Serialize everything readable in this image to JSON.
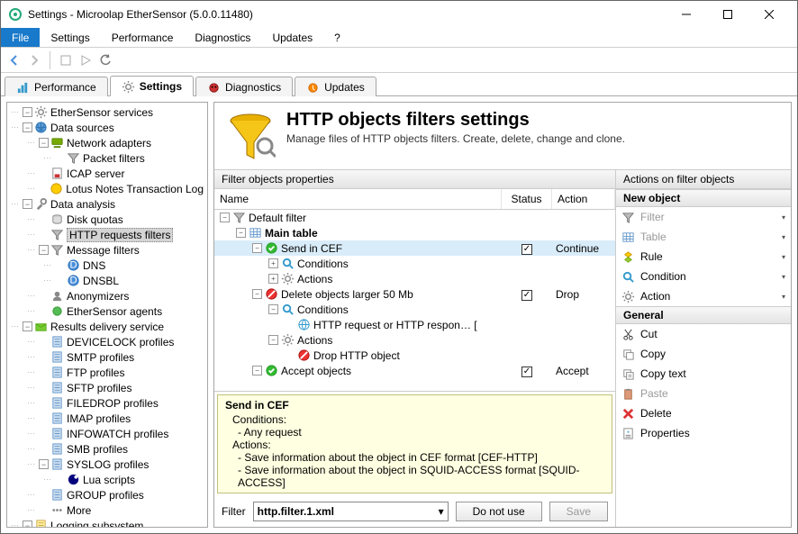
{
  "window": {
    "title": "Settings - Microolap EtherSensor (5.0.0.11480)"
  },
  "menubar": [
    "File",
    "Settings",
    "Performance",
    "Diagnostics",
    "Updates",
    "?"
  ],
  "tabs": [
    {
      "label": "Performance",
      "icon": "chart"
    },
    {
      "label": "Settings",
      "icon": "gear",
      "active": true
    },
    {
      "label": "Diagnostics",
      "icon": "bug"
    },
    {
      "label": "Updates",
      "icon": "update"
    }
  ],
  "sidebar": [
    {
      "d": 0,
      "e": "-",
      "i": "gear",
      "t": "EtherSensor services"
    },
    {
      "d": 0,
      "e": "-",
      "i": "globe",
      "t": "Data sources"
    },
    {
      "d": 1,
      "e": "-",
      "i": "net",
      "t": "Network adapters"
    },
    {
      "d": 2,
      "e": "",
      "i": "filter",
      "t": "Packet filters"
    },
    {
      "d": 1,
      "e": "",
      "i": "icap",
      "t": "ICAP server"
    },
    {
      "d": 1,
      "e": "",
      "i": "lotus",
      "t": "Lotus Notes Transaction Log"
    },
    {
      "d": 0,
      "e": "-",
      "i": "tools",
      "t": "Data analysis"
    },
    {
      "d": 1,
      "e": "",
      "i": "disk",
      "t": "Disk quotas"
    },
    {
      "d": 1,
      "e": "",
      "i": "filter",
      "t": "HTTP requests filters",
      "sel": true
    },
    {
      "d": 1,
      "e": "-",
      "i": "filter",
      "t": "Message filters"
    },
    {
      "d": 2,
      "e": "",
      "i": "dns",
      "t": "DNS"
    },
    {
      "d": 2,
      "e": "",
      "i": "dns",
      "t": "DNSBL"
    },
    {
      "d": 1,
      "e": "",
      "i": "anon",
      "t": "Anonymizers"
    },
    {
      "d": 1,
      "e": "",
      "i": "agent",
      "t": "EtherSensor agents"
    },
    {
      "d": 0,
      "e": "-",
      "i": "deliv",
      "t": "Results delivery service"
    },
    {
      "d": 1,
      "e": "",
      "i": "prof",
      "t": "DEVICELOCK profiles"
    },
    {
      "d": 1,
      "e": "",
      "i": "prof",
      "t": "SMTP profiles"
    },
    {
      "d": 1,
      "e": "",
      "i": "prof",
      "t": "FTP profiles"
    },
    {
      "d": 1,
      "e": "",
      "i": "prof",
      "t": "SFTP profiles"
    },
    {
      "d": 1,
      "e": "",
      "i": "prof",
      "t": "FILEDROP profiles"
    },
    {
      "d": 1,
      "e": "",
      "i": "prof",
      "t": "IMAP profiles"
    },
    {
      "d": 1,
      "e": "",
      "i": "prof",
      "t": "INFOWATCH profiles"
    },
    {
      "d": 1,
      "e": "",
      "i": "prof",
      "t": "SMB profiles"
    },
    {
      "d": 1,
      "e": "-",
      "i": "prof",
      "t": "SYSLOG profiles"
    },
    {
      "d": 2,
      "e": "",
      "i": "lua",
      "t": "Lua scripts"
    },
    {
      "d": 1,
      "e": "",
      "i": "prof",
      "t": "GROUP profiles"
    },
    {
      "d": 1,
      "e": "",
      "i": "more",
      "t": "More"
    },
    {
      "d": 0,
      "e": "-",
      "i": "log",
      "t": "Logging subsystem"
    }
  ],
  "main": {
    "title": "HTTP objects filters settings",
    "subtitle": "Manage files of HTTP objects filters. Create, delete, change and clone.",
    "filterPaneTitle": "Filter objects properties",
    "actionsPaneTitle": "Actions on filter objects",
    "cols": {
      "name": "Name",
      "status": "Status",
      "action": "Action"
    },
    "rows": [
      {
        "d": 0,
        "e": "-",
        "i": "filter",
        "t": "Default filter"
      },
      {
        "d": 1,
        "e": "-",
        "i": "table",
        "t": "Main table",
        "bold": true
      },
      {
        "d": 2,
        "e": "-",
        "i": "ok",
        "t": "Send in CEF",
        "chk": true,
        "act": "Continue",
        "sel": true
      },
      {
        "d": 3,
        "e": "+",
        "i": "cond",
        "t": "Conditions"
      },
      {
        "d": 3,
        "e": "+",
        "i": "act",
        "t": "Actions"
      },
      {
        "d": 2,
        "e": "-",
        "i": "no",
        "t": "Delete objects larger 50 Mb",
        "chk": true,
        "act": "Drop"
      },
      {
        "d": 3,
        "e": "-",
        "i": "cond",
        "t": "Conditions"
      },
      {
        "d": 4,
        "e": "",
        "i": "http",
        "t": "HTTP request or HTTP respon… ["
      },
      {
        "d": 3,
        "e": "-",
        "i": "act",
        "t": "Actions"
      },
      {
        "d": 4,
        "e": "",
        "i": "no",
        "t": "Drop HTTP object"
      },
      {
        "d": 2,
        "e": "-",
        "i": "ok",
        "t": "Accept objects",
        "chk": true,
        "act": "Accept"
      }
    ],
    "detail": {
      "title": "Send in CEF",
      "condLabel": "Conditions:",
      "cond": "- Any request",
      "actLabel": "Actions:",
      "acts": [
        "- Save information about the object in CEF format [CEF-HTTP]",
        "- Save information about the object in SQUID-ACCESS format [SQUID-ACCESS]"
      ]
    },
    "bottom": {
      "label": "Filter",
      "value": "http.filter.1.xml",
      "notuse": "Do not use",
      "save": "Save"
    }
  },
  "actions": {
    "g1": "New object",
    "g1items": [
      {
        "i": "filter",
        "t": "Filter",
        "dis": true,
        "caret": true
      },
      {
        "i": "table",
        "t": "Table",
        "dis": true,
        "caret": true
      },
      {
        "i": "rule",
        "t": "Rule",
        "caret": true
      },
      {
        "i": "cond",
        "t": "Condition",
        "caret": true
      },
      {
        "i": "act",
        "t": "Action",
        "caret": true
      }
    ],
    "g2": "General",
    "g2items": [
      {
        "i": "cut",
        "t": "Cut"
      },
      {
        "i": "copy",
        "t": "Copy"
      },
      {
        "i": "copyt",
        "t": "Copy text"
      },
      {
        "i": "paste",
        "t": "Paste",
        "dis": true
      },
      {
        "i": "del",
        "t": "Delete"
      },
      {
        "i": "prop",
        "t": "Properties"
      }
    ]
  }
}
